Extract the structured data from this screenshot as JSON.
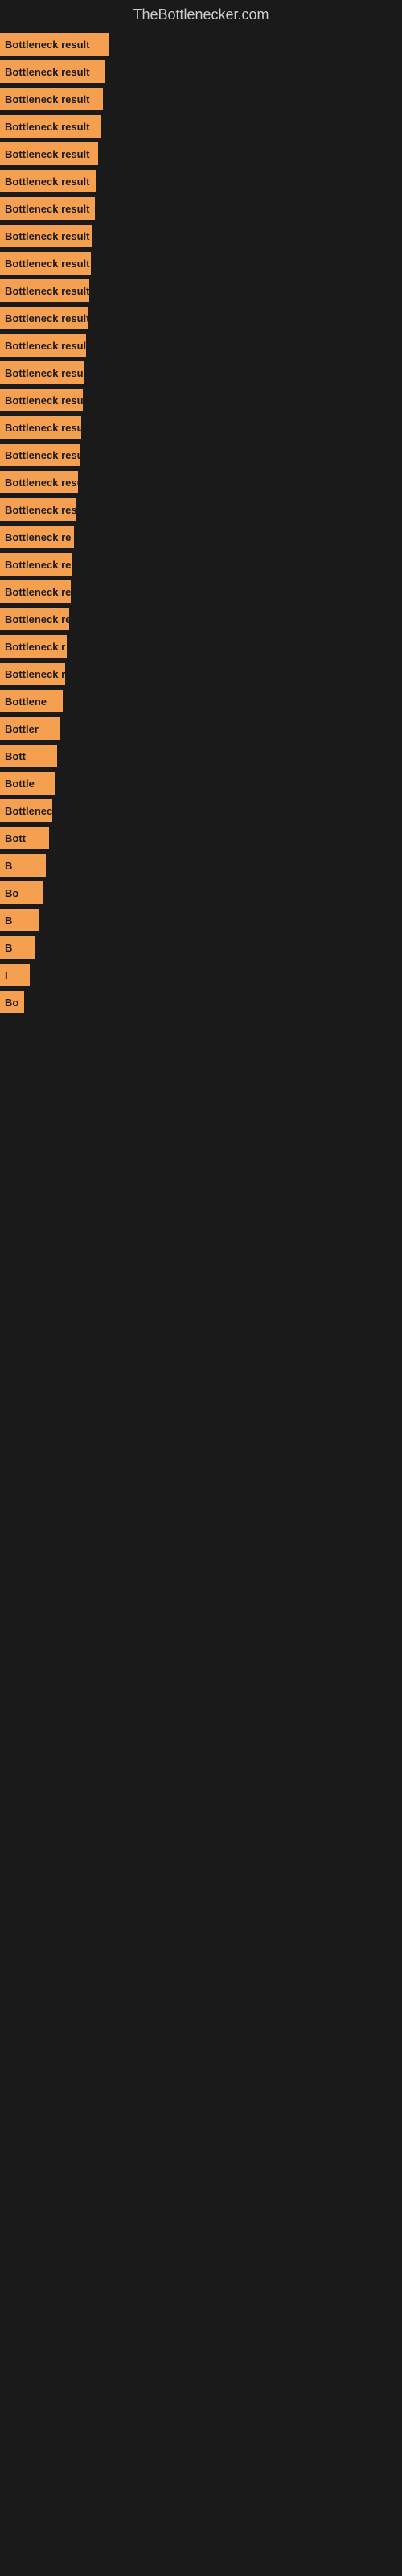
{
  "site": {
    "title": "TheBottlenecker.com"
  },
  "bars": [
    {
      "label": "Bottleneck result",
      "width": 135
    },
    {
      "label": "Bottleneck result",
      "width": 130
    },
    {
      "label": "Bottleneck result",
      "width": 128
    },
    {
      "label": "Bottleneck result",
      "width": 125
    },
    {
      "label": "Bottleneck result",
      "width": 122
    },
    {
      "label": "Bottleneck result",
      "width": 120
    },
    {
      "label": "Bottleneck result",
      "width": 118
    },
    {
      "label": "Bottleneck result",
      "width": 115
    },
    {
      "label": "Bottleneck result",
      "width": 113
    },
    {
      "label": "Bottleneck result",
      "width": 111
    },
    {
      "label": "Bottleneck result",
      "width": 109
    },
    {
      "label": "Bottleneck result",
      "width": 107
    },
    {
      "label": "Bottleneck result",
      "width": 105
    },
    {
      "label": "Bottleneck result",
      "width": 103
    },
    {
      "label": "Bottleneck result",
      "width": 101
    },
    {
      "label": "Bottleneck result",
      "width": 99
    },
    {
      "label": "Bottleneck result",
      "width": 97
    },
    {
      "label": "Bottleneck resu",
      "width": 95
    },
    {
      "label": "Bottleneck re",
      "width": 92
    },
    {
      "label": "Bottleneck resu",
      "width": 90
    },
    {
      "label": "Bottleneck res",
      "width": 88
    },
    {
      "label": "Bottleneck result",
      "width": 86
    },
    {
      "label": "Bottleneck r",
      "width": 83
    },
    {
      "label": "Bottleneck resu",
      "width": 81
    },
    {
      "label": "Bottlene",
      "width": 78
    },
    {
      "label": "Bottler",
      "width": 75
    },
    {
      "label": "Bott",
      "width": 71
    },
    {
      "label": "Bottle",
      "width": 68
    },
    {
      "label": "Bottlenec",
      "width": 65
    },
    {
      "label": "Bott",
      "width": 61
    },
    {
      "label": "B",
      "width": 57
    },
    {
      "label": "Bo",
      "width": 53
    },
    {
      "label": "B",
      "width": 48
    },
    {
      "label": "B",
      "width": 43
    },
    {
      "label": "I",
      "width": 37
    },
    {
      "label": "Bo",
      "width": 30
    }
  ]
}
